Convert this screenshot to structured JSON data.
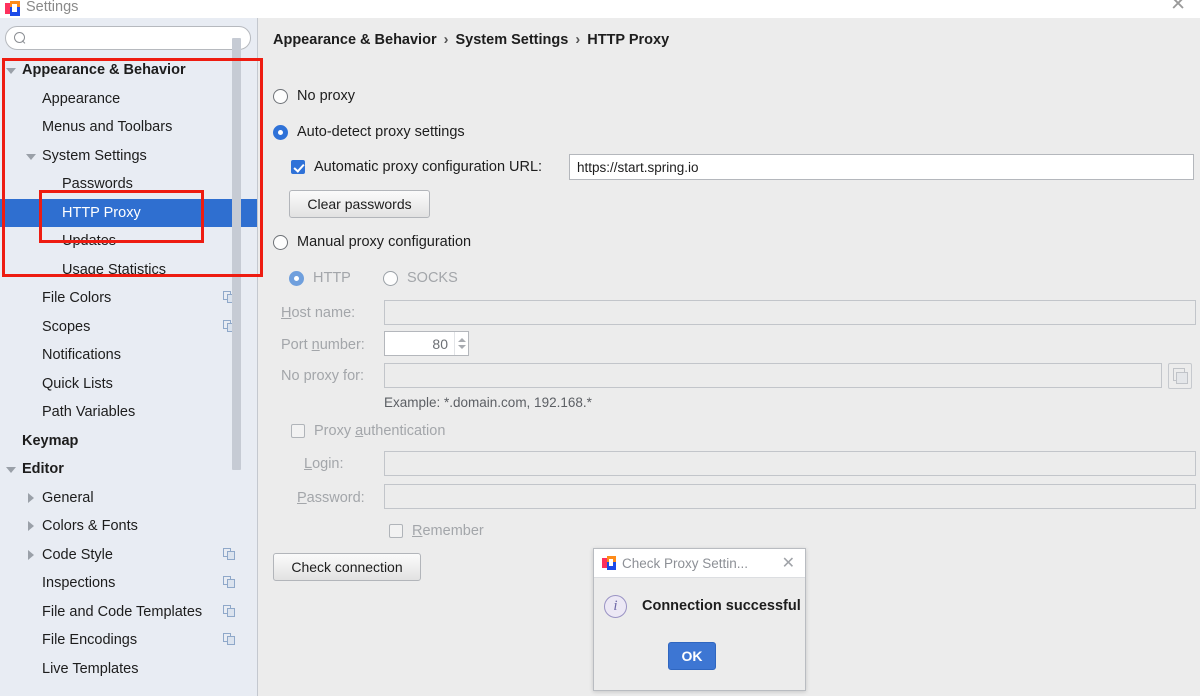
{
  "window": {
    "title": "Settings",
    "icon": "intellij-logo-icon",
    "close_label": "✕"
  },
  "search": {
    "value": "",
    "placeholder": "",
    "icon": "search-icon"
  },
  "sidebar": {
    "items": [
      {
        "label": "Appearance & Behavior",
        "level": 0,
        "bold": true,
        "arrow": "down",
        "selected": false,
        "copy_icon": false
      },
      {
        "label": "Appearance",
        "level": 1,
        "bold": false,
        "arrow": "",
        "selected": false,
        "copy_icon": false
      },
      {
        "label": "Menus and Toolbars",
        "level": 1,
        "bold": false,
        "arrow": "",
        "selected": false,
        "copy_icon": false
      },
      {
        "label": "System Settings",
        "level": 1,
        "bold": false,
        "arrow": "down",
        "selected": false,
        "copy_icon": false
      },
      {
        "label": "Passwords",
        "level": 2,
        "bold": false,
        "arrow": "",
        "selected": false,
        "copy_icon": false
      },
      {
        "label": "HTTP Proxy",
        "level": 2,
        "bold": false,
        "arrow": "",
        "selected": true,
        "copy_icon": false
      },
      {
        "label": "Updates",
        "level": 2,
        "bold": false,
        "arrow": "",
        "selected": false,
        "copy_icon": false
      },
      {
        "label": "Usage Statistics",
        "level": 2,
        "bold": false,
        "arrow": "",
        "selected": false,
        "copy_icon": false
      },
      {
        "label": "File Colors",
        "level": 1,
        "bold": false,
        "arrow": "",
        "selected": false,
        "copy_icon": true
      },
      {
        "label": "Scopes",
        "level": 1,
        "bold": false,
        "arrow": "",
        "selected": false,
        "copy_icon": true
      },
      {
        "label": "Notifications",
        "level": 1,
        "bold": false,
        "arrow": "",
        "selected": false,
        "copy_icon": false
      },
      {
        "label": "Quick Lists",
        "level": 1,
        "bold": false,
        "arrow": "",
        "selected": false,
        "copy_icon": false
      },
      {
        "label": "Path Variables",
        "level": 1,
        "bold": false,
        "arrow": "",
        "selected": false,
        "copy_icon": false
      },
      {
        "label": "Keymap",
        "level": 0,
        "bold": true,
        "arrow": "",
        "selected": false,
        "copy_icon": false
      },
      {
        "label": "Editor",
        "level": 0,
        "bold": true,
        "arrow": "down",
        "selected": false,
        "copy_icon": false
      },
      {
        "label": "General",
        "level": 1,
        "bold": false,
        "arrow": "right",
        "selected": false,
        "copy_icon": false
      },
      {
        "label": "Colors & Fonts",
        "level": 1,
        "bold": false,
        "arrow": "right",
        "selected": false,
        "copy_icon": false
      },
      {
        "label": "Code Style",
        "level": 1,
        "bold": false,
        "arrow": "right",
        "selected": false,
        "copy_icon": true
      },
      {
        "label": "Inspections",
        "level": 1,
        "bold": false,
        "arrow": "",
        "selected": false,
        "copy_icon": true
      },
      {
        "label": "File and Code Templates",
        "level": 1,
        "bold": false,
        "arrow": "",
        "selected": false,
        "copy_icon": true
      },
      {
        "label": "File Encodings",
        "level": 1,
        "bold": false,
        "arrow": "",
        "selected": false,
        "copy_icon": true
      },
      {
        "label": "Live Templates",
        "level": 1,
        "bold": false,
        "arrow": "",
        "selected": false,
        "copy_icon": false
      }
    ]
  },
  "breadcrumb": {
    "part1": "Appearance & Behavior",
    "sep1": "›",
    "part2": "System Settings",
    "sep2": "›",
    "part3": "HTTP Proxy"
  },
  "form": {
    "no_proxy_label": "No proxy",
    "no_proxy_selected": false,
    "auto_detect_label": "Auto-detect proxy settings",
    "auto_detect_selected": true,
    "auto_config_url_label": "Automatic proxy configuration URL:",
    "auto_config_url_checked": true,
    "auto_config_url_value": "https://start.spring.io",
    "clear_passwords_label": "Clear passwords",
    "manual_label": "Manual proxy configuration",
    "manual_selected": false,
    "http_label": "HTTP",
    "http_selected": true,
    "socks_label": "SOCKS",
    "socks_selected": false,
    "host_name_label": "Host name:",
    "host_name_value": "",
    "port_number_label": "Port number:",
    "port_number_value": "80",
    "no_proxy_for_label": "No proxy for:",
    "no_proxy_for_value": "",
    "example_hint": "Example: *.domain.com, 192.168.*",
    "proxy_auth_label": "Proxy authentication",
    "proxy_auth_checked": false,
    "login_label": "Login:",
    "login_value": "",
    "password_label": "Password:",
    "password_value": "",
    "remember_label": "Remember",
    "remember_checked": false,
    "check_connection_label": "Check connection",
    "browse_icon": "browse-folder-icon"
  },
  "dialog": {
    "icon": "intellij-logo-icon",
    "title": "Check Proxy Settin...",
    "close_label": "✕",
    "info_icon": "info-icon",
    "message": "Connection successful",
    "ok_label": "OK"
  },
  "annotations": {
    "color": "#ee1c11",
    "boxes": [
      {
        "name": "outer-highlight-box"
      },
      {
        "name": "inner-highlight-box"
      }
    ]
  }
}
